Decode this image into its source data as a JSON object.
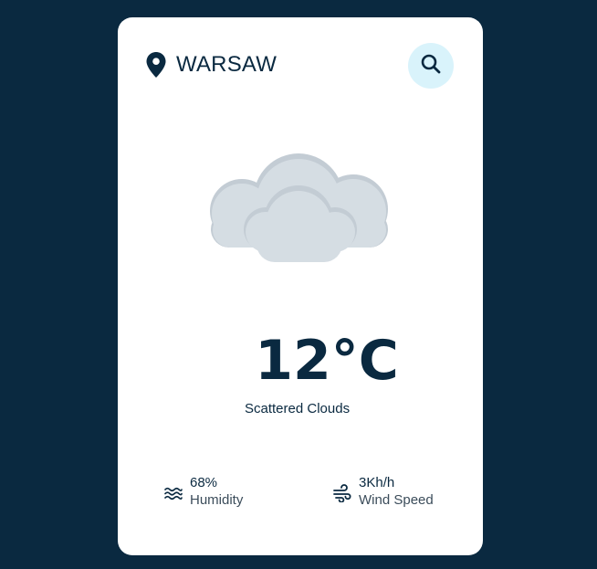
{
  "location": {
    "city": "WARSAW",
    "icon": "map-pin-icon"
  },
  "search": {
    "icon": "search-icon"
  },
  "weather": {
    "icon": "cloud-icon",
    "temperature": "12°C",
    "description": "Scattered Clouds"
  },
  "stats": {
    "humidity": {
      "value": "68%",
      "label": "Humidity",
      "icon": "waves-icon"
    },
    "wind": {
      "value": "3Kh/h",
      "label": "Wind Speed",
      "icon": "wind-icon"
    }
  },
  "colors": {
    "background": "#0a2940",
    "card": "#ffffff",
    "accent": "#d9f3fb",
    "text": "#0a2940"
  }
}
